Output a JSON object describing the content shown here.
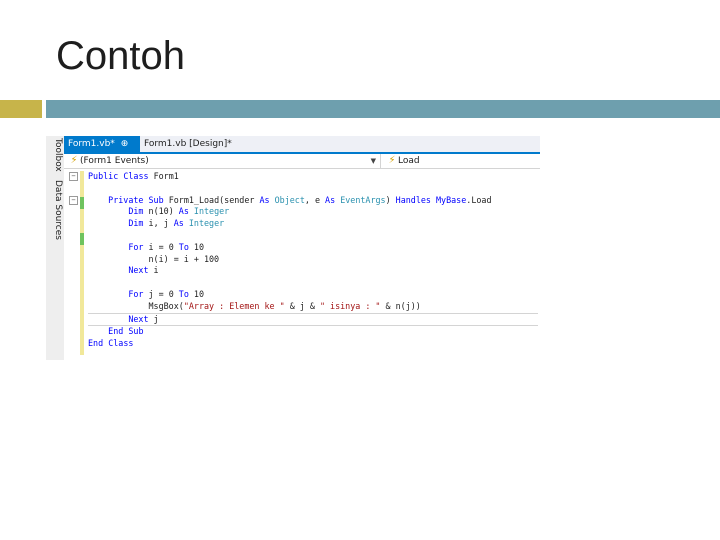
{
  "slide": {
    "title": "Contoh"
  },
  "ide": {
    "side_tabs": [
      "Toolbox",
      "Data Sources"
    ],
    "tabs": [
      {
        "label": "Form1.vb*",
        "active": true
      },
      {
        "label": "Form1.vb [Design]*",
        "active": false
      }
    ],
    "nav": {
      "left": "(Form1 Events)",
      "right": "Load"
    },
    "code_lines": [
      "Public Class Form1",
      "",
      "    Private Sub Form1_Load(sender As Object, e As EventArgs) Handles MyBase.Load",
      "        Dim n(10) As Integer",
      "        Dim i, j As Integer",
      "",
      "        For i = 0 To 10",
      "            n(i) = i + 100",
      "        Next i",
      "",
      "        For j = 0 To 10",
      "            MsgBox(\"Array : Elemen ke \" & j & \" isinya : \" & n(j))",
      "        Next j",
      "    End Sub",
      "End Class"
    ]
  },
  "colors": {
    "accent_rule": "#c7b44a",
    "title_rule": "#6e9fae",
    "ide_active_tab": "#007acc",
    "keyword": "#0000ff",
    "type": "#2b91af",
    "string": "#a31515"
  }
}
